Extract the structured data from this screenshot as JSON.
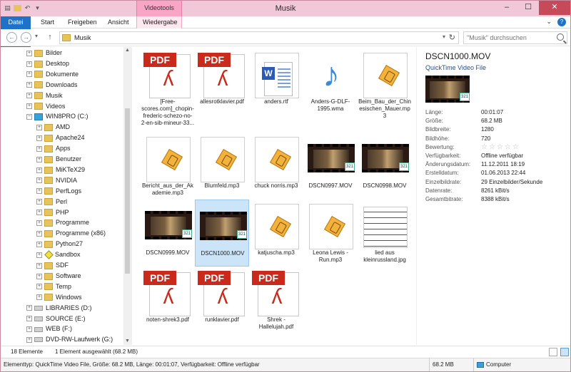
{
  "window": {
    "title": "Musik",
    "context_tab_header": "Videotools"
  },
  "ribbon": {
    "tabs": [
      "Datei",
      "Start",
      "Freigeben",
      "Ansicht",
      "Wiedergabe"
    ]
  },
  "navigation": {
    "address": "Musik",
    "search_placeholder": "\"Musik\" durchsuchen"
  },
  "sidebar": {
    "items": [
      {
        "label": "Bilder",
        "icon": "folder-icon",
        "level": 1
      },
      {
        "label": "Desktop",
        "icon": "folder-icon",
        "level": 1
      },
      {
        "label": "Dokumente",
        "icon": "folder-icon",
        "level": 1
      },
      {
        "label": "Downloads",
        "icon": "folder-icon",
        "level": 1
      },
      {
        "label": "Musik",
        "icon": "folder-icon",
        "level": 1
      },
      {
        "label": "Videos",
        "icon": "folder-icon",
        "level": 1
      },
      {
        "label": "WIN8PRO (C:)",
        "icon": "windows-drive-icon",
        "level": 1
      },
      {
        "label": "AMD",
        "icon": "folder-icon",
        "level": 2
      },
      {
        "label": "Apache24",
        "icon": "folder-icon",
        "level": 2
      },
      {
        "label": "Apps",
        "icon": "folder-icon",
        "level": 2
      },
      {
        "label": "Benutzer",
        "icon": "folder-icon",
        "level": 2
      },
      {
        "label": "MiKTeX29",
        "icon": "folder-icon",
        "level": 2
      },
      {
        "label": "NVIDIA",
        "icon": "folder-icon",
        "level": 2
      },
      {
        "label": "PerfLogs",
        "icon": "folder-icon",
        "level": 2
      },
      {
        "label": "Perl",
        "icon": "folder-icon",
        "level": 2
      },
      {
        "label": "PHP",
        "icon": "folder-icon",
        "level": 2
      },
      {
        "label": "Programme",
        "icon": "folder-icon",
        "level": 2
      },
      {
        "label": "Programme (x86)",
        "icon": "folder-icon",
        "level": 2
      },
      {
        "label": "Python27",
        "icon": "folder-icon",
        "level": 2
      },
      {
        "label": "Sandbox",
        "icon": "sandbox-icon",
        "level": 2
      },
      {
        "label": "SDF",
        "icon": "folder-icon",
        "level": 2
      },
      {
        "label": "Software",
        "icon": "folder-icon",
        "level": 2
      },
      {
        "label": "Temp",
        "icon": "folder-icon",
        "level": 2
      },
      {
        "label": "Windows",
        "icon": "folder-icon",
        "level": 2
      },
      {
        "label": "LIBRARIES (D:)",
        "icon": "drive-icon",
        "level": 1
      },
      {
        "label": "SOURCE (E:)",
        "icon": "drive-icon",
        "level": 1
      },
      {
        "label": "WEB (F:)",
        "icon": "drive-icon",
        "level": 1
      },
      {
        "label": "DVD-RW-Laufwerk (G:)",
        "icon": "dvd-drive-icon",
        "level": 1
      }
    ]
  },
  "files": [
    {
      "name": "[Free-scores.com]_chopin-frederic-schezo-no-2-en-sib-mineur-33...",
      "type": "pdf"
    },
    {
      "name": "allesrotklavier.pdf",
      "type": "pdf"
    },
    {
      "name": "anders.rtf",
      "type": "rtf"
    },
    {
      "name": "Anders-G-DLF-1995.wma",
      "type": "wma"
    },
    {
      "name": "Beim_Bau_der_Chinesischen_Mauer.mp3",
      "type": "mp3"
    },
    {
      "name": "Bericht_aus_der_Akademie.mp3",
      "type": "mp3"
    },
    {
      "name": "Blumfeld.mp3",
      "type": "mp3"
    },
    {
      "name": "chuck norris.mp3",
      "type": "mp3"
    },
    {
      "name": "DSCN0997.MOV",
      "type": "mov"
    },
    {
      "name": "DSCN0998.MOV",
      "type": "mov"
    },
    {
      "name": "DSCN0999.MOV",
      "type": "mov"
    },
    {
      "name": "DSCN1000.MOV",
      "type": "mov",
      "selected": true
    },
    {
      "name": "katjuscha.mp3",
      "type": "mp3"
    },
    {
      "name": "Leona Lewis - Run.mp3",
      "type": "mp3"
    },
    {
      "name": "lied aus kleinrussland.jpg",
      "type": "jpg"
    },
    {
      "name": "noten-shrek3.pdf",
      "type": "pdf"
    },
    {
      "name": "runklavier.pdf",
      "type": "pdf"
    },
    {
      "name": "Shrek - Hallelujah.pdf",
      "type": "pdf"
    }
  ],
  "details": {
    "title": "DSCN1000.MOV",
    "subtitle": "QuickTime Video File",
    "properties": [
      {
        "key": "Länge:",
        "value": "00:01:07"
      },
      {
        "key": "Größe:",
        "value": "68.2 MB"
      },
      {
        "key": "Bildbreite:",
        "value": "1280"
      },
      {
        "key": "Bildhöhe:",
        "value": "720"
      },
      {
        "key": "Bewertung:",
        "value": ""
      },
      {
        "key": "Verfügbarkeit:",
        "value": "Offline verfügbar"
      },
      {
        "key": "Änderungsdatum:",
        "value": "11.12.2011 18:19"
      },
      {
        "key": "Erstelldatum:",
        "value": "01.06.2013 22:44"
      },
      {
        "key": "Einzelbildrate:",
        "value": "29 Einzelbilder/Sekunde"
      },
      {
        "key": "Datenrate:",
        "value": "8261 kBit/s"
      },
      {
        "key": "Gesamtbitrate:",
        "value": "8388 kBit/s"
      }
    ],
    "rating_stars": 0
  },
  "status": {
    "count": "18 Elemente",
    "selection": "1 Element ausgewählt (68.2 MB)",
    "info": "Elementtyp: QuickTime Video File, Größe: 68.2 MB, Länge: 00:01:07, Verfügbarkeit: Offline verfügbar",
    "size": "68.2 MB",
    "location": "Computer"
  },
  "colors": {
    "titlebar": "#f0c8d8",
    "context_tab": "#f9a6c6",
    "file_tab": "#1e73c8",
    "selection": "#cce4f7",
    "close_button": "#c74a5a"
  }
}
